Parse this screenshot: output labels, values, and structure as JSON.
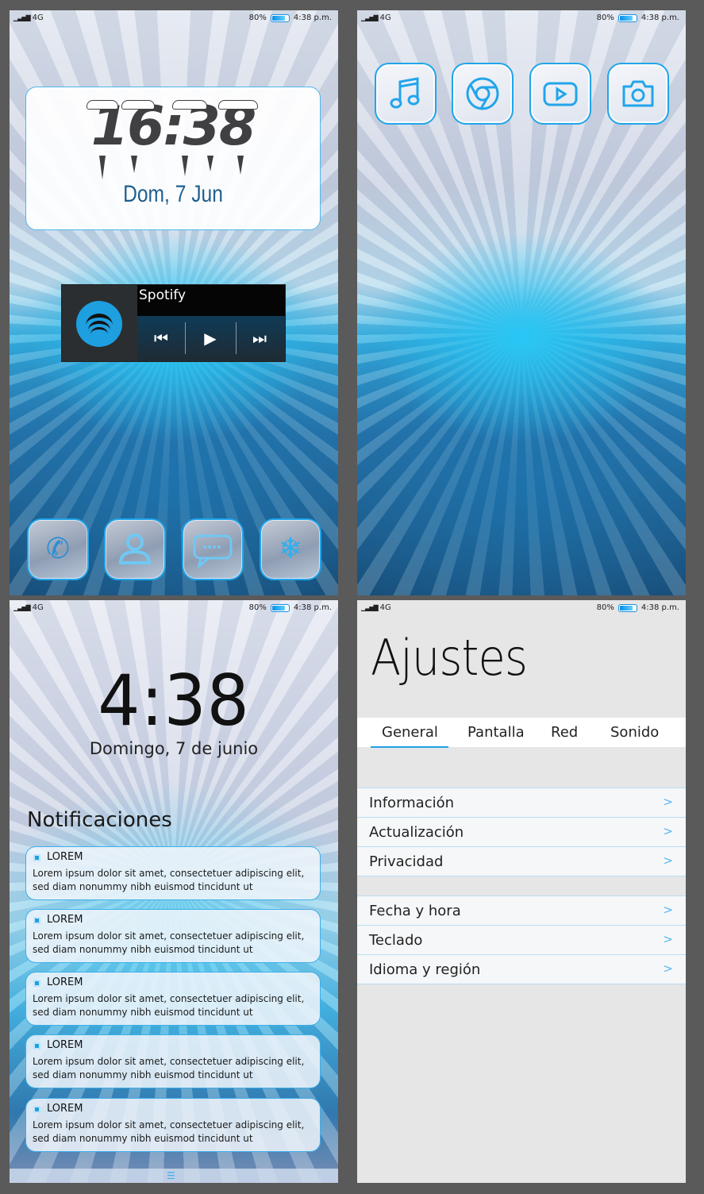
{
  "status_bar": {
    "network": "4G",
    "battery": "80%",
    "time": "4:38 p.m.",
    "battery_level": 0.8,
    "accent": "#1a8fe0"
  },
  "home": {
    "clock_time": "16:38",
    "clock_date": "Dom, 7 Jun",
    "music_widget": {
      "app": "Spotify",
      "prev_icon": "skip-previous-icon",
      "play_icon": "play-icon",
      "next_icon": "skip-next-icon"
    },
    "dock": [
      "phone-icon",
      "contacts-icon",
      "messages-icon",
      "snowflake-icon"
    ]
  },
  "apps": [
    "music-icon",
    "chrome-icon",
    "youtube-icon",
    "camera-icon"
  ],
  "lock": {
    "time": "4:38",
    "date": "Domingo, 7 de junio",
    "notifications_title": "Notificaciones",
    "notifications": [
      {
        "title": "LOREM",
        "text": "Lorem ipsum dolor sit amet, consectetuer adipiscing elit, sed diam nonummy nibh euismod tincidunt ut"
      },
      {
        "title": "LOREM",
        "text": "Lorem ipsum dolor sit amet, consectetuer adipiscing elit, sed diam nonummy nibh euismod tincidunt ut"
      },
      {
        "title": "LOREM",
        "text": "Lorem ipsum dolor sit amet, consectetuer adipiscing elit, sed diam nonummy nibh euismod tincidunt ut"
      },
      {
        "title": "LOREM",
        "text": "Lorem ipsum dolor sit amet, consectetuer adipiscing elit, sed diam nonummy nibh euismod tincidunt ut"
      },
      {
        "title": "LOREM",
        "text": "Lorem ipsum dolor sit amet, consectetuer adipiscing elit, sed diam nonummy nibh euismod tincidunt ut"
      }
    ]
  },
  "settings": {
    "title": "Ajustes",
    "tabs": [
      "General",
      "Pantalla",
      "Red",
      "Sonido"
    ],
    "active_tab": "General",
    "groups": [
      [
        "Información",
        "Actualización",
        "Privacidad"
      ],
      [
        "Fecha y hora",
        "Teclado",
        "Idioma y región"
      ]
    ]
  }
}
